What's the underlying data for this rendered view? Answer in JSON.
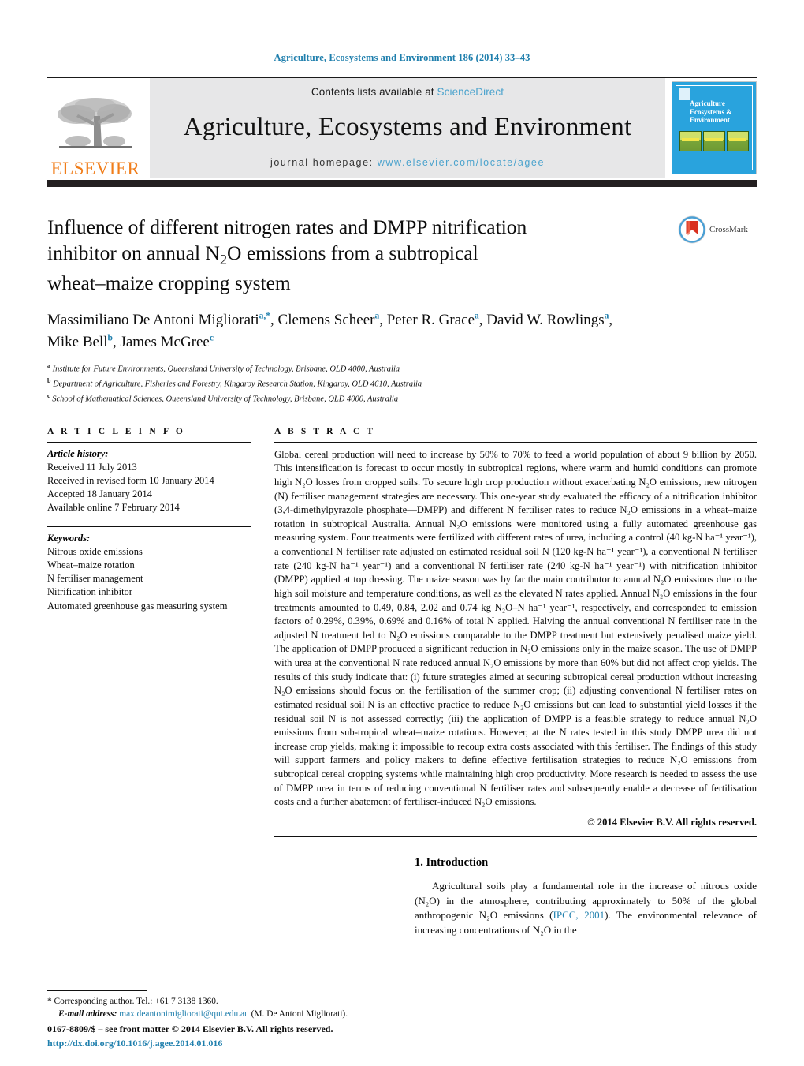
{
  "running_head": "Agriculture, Ecosystems and Environment 186 (2014) 33–43",
  "masthead": {
    "publisher_name": "ELSEVIER",
    "contents_prefix": "Contents lists available at ",
    "contents_link": "ScienceDirect",
    "journal_title": "Agriculture, Ecosystems and Environment",
    "homepage_prefix": "journal homepage: ",
    "homepage_url": "www.elsevier.com/locate/agee",
    "cover_title": "Agriculture Ecosystems & Environment"
  },
  "article": {
    "title_line1": "Influence of different nitrogen rates and DMPP nitrification",
    "title_line2_a": "inhibitor on annual N",
    "title_line2_sub": "2",
    "title_line2_b": "O emissions from a subtropical",
    "title_line3": "wheat–maize cropping system",
    "crossmark_label": "CrossMark",
    "authors": [
      {
        "name": "Massimiliano De Antoni Migliorati",
        "marks": "a,*"
      },
      {
        "name": "Clemens Scheer",
        "marks": "a"
      },
      {
        "name": "Peter R. Grace",
        "marks": "a"
      },
      {
        "name": "David W. Rowlings",
        "marks": "a"
      },
      {
        "name": "Mike Bell",
        "marks": "b"
      },
      {
        "name": "James McGree",
        "marks": "c"
      }
    ],
    "affiliations": [
      {
        "mark": "a",
        "text": "Institute for Future Environments, Queensland University of Technology, Brisbane, QLD 4000, Australia"
      },
      {
        "mark": "b",
        "text": "Department of Agriculture, Fisheries and Forestry, Kingaroy Research Station, Kingaroy, QLD 4610, Australia"
      },
      {
        "mark": "c",
        "text": "School of Mathematical Sciences, Queensland University of Technology, Brisbane, QLD 4000, Australia"
      }
    ]
  },
  "article_info": {
    "heading": "A R T I C L E   I N F O",
    "history_label": "Article history:",
    "history": [
      "Received 11 July 2013",
      "Received in revised form 10 January 2014",
      "Accepted 18 January 2014",
      "Available online 7 February 2014"
    ],
    "keywords_label": "Keywords:",
    "keywords": [
      "Nitrous oxide emissions",
      "Wheat–maize rotation",
      "N fertiliser management",
      "Nitrification inhibitor",
      "Automated greenhouse gas measuring system"
    ]
  },
  "abstract": {
    "heading": "A B S T R A C T",
    "text": "Global cereal production will need to increase by 50% to 70% to feed a world population of about 9 billion by 2050. This intensification is forecast to occur mostly in subtropical regions, where warm and humid conditions can promote high N₂O losses from cropped soils. To secure high crop production without exacerbating N₂O emissions, new nitrogen (N) fertiliser management strategies are necessary. This one-year study evaluated the efficacy of a nitrification inhibitor (3,4-dimethylpyrazole phosphate—DMPP) and different N fertiliser rates to reduce N₂O emissions in a wheat–maize rotation in subtropical Australia. Annual N₂O emissions were monitored using a fully automated greenhouse gas measuring system. Four treatments were fertilized with different rates of urea, including a control (40 kg-N ha⁻¹ year⁻¹), a conventional N fertiliser rate adjusted on estimated residual soil N (120 kg-N ha⁻¹ year⁻¹), a conventional N fertiliser rate (240 kg-N ha⁻¹ year⁻¹) and a conventional N fertiliser rate (240 kg-N ha⁻¹ year⁻¹) with nitrification inhibitor (DMPP) applied at top dressing. The maize season was by far the main contributor to annual N₂O emissions due to the high soil moisture and temperature conditions, as well as the elevated N rates applied. Annual N₂O emissions in the four treatments amounted to 0.49, 0.84, 2.02 and 0.74 kg N₂O–N ha⁻¹ year⁻¹, respectively, and corresponded to emission factors of 0.29%, 0.39%, 0.69% and 0.16% of total N applied. Halving the annual conventional N fertiliser rate in the adjusted N treatment led to N₂O emissions comparable to the DMPP treatment but extensively penalised maize yield. The application of DMPP produced a significant reduction in N₂O emissions only in the maize season. The use of DMPP with urea at the conventional N rate reduced annual N₂O emissions by more than 60% but did not affect crop yields. The results of this study indicate that: (i) future strategies aimed at securing subtropical cereal production without increasing N₂O emissions should focus on the fertilisation of the summer crop; (ii) adjusting conventional N fertiliser rates on estimated residual soil N is an effective practice to reduce N₂O emissions but can lead to substantial yield losses if the residual soil N is not assessed correctly; (iii) the application of DMPP is a feasible strategy to reduce annual N₂O emissions from sub-tropical wheat–maize rotations. However, at the N rates tested in this study DMPP urea did not increase crop yields, making it impossible to recoup extra costs associated with this fertiliser. The findings of this study will support farmers and policy makers to define effective fertilisation strategies to reduce N₂O emissions from subtropical cereal cropping systems while maintaining high crop productivity. More research is needed to assess the use of DMPP urea in terms of reducing conventional N fertiliser rates and subsequently enable a decrease of fertilisation costs and a further abatement of fertiliser-induced N₂O emissions.",
    "copyright": "© 2014 Elsevier B.V. All rights reserved."
  },
  "introduction": {
    "heading": "1.  Introduction",
    "para_part1": "Agricultural soils play a fundamental role in the increase of nitrous oxide (N₂O) in the atmosphere, contributing approximately to 50% of the global anthropogenic N₂O emissions (",
    "citation": "IPCC, 2001",
    "para_part2": "). The environmental relevance of increasing concentrations of N₂O in the"
  },
  "footnotes": {
    "corresponding": "* Corresponding author. Tel.: +61 7 3138 1360.",
    "email_label": "E-mail address:",
    "email": "max.deantonimigliorati@qut.edu.au",
    "email_suffix": " (M. De Antoni Migliorati)."
  },
  "imprint": {
    "line1": "0167-8809/$ – see front matter © 2014 Elsevier B.V. All rights reserved.",
    "doi": "http://dx.doi.org/10.1016/j.agee.2014.01.016"
  },
  "colors": {
    "link_blue": "#1f7fad",
    "sciencedirect_blue": "#4ba3cd",
    "elsevier_orange": "#f07d1a",
    "band_grey": "#e7e7e8",
    "rule_dark": "#231f20",
    "cover_blue": "#29a3dd"
  }
}
